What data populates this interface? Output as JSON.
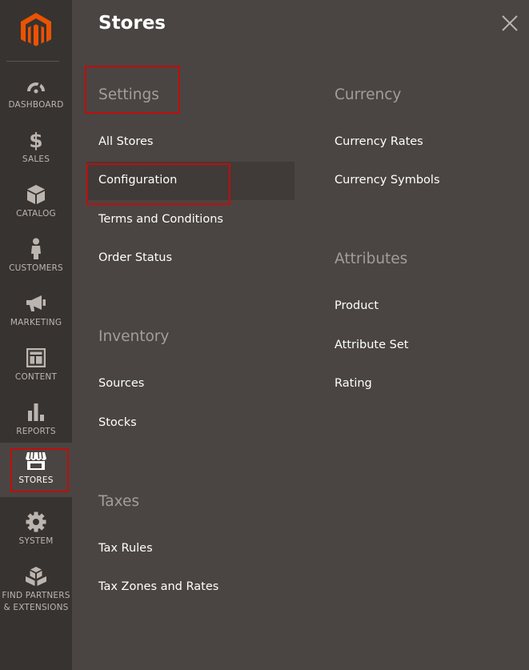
{
  "sidebar": {
    "items": [
      {
        "label": "DASHBOARD",
        "icon": "dashboard-gauge-icon"
      },
      {
        "label": "SALES",
        "icon": "dollar-sign-icon"
      },
      {
        "label": "CATALOG",
        "icon": "cube-icon"
      },
      {
        "label": "CUSTOMERS",
        "icon": "person-icon"
      },
      {
        "label": "MARKETING",
        "icon": "megaphone-icon"
      },
      {
        "label": "CONTENT",
        "icon": "layout-icon"
      },
      {
        "label": "REPORTS",
        "icon": "bar-chart-icon"
      },
      {
        "label": "STORES",
        "icon": "storefront-icon"
      },
      {
        "label": "SYSTEM",
        "icon": "gear-icon"
      },
      {
        "label_line1": "FIND PARTNERS",
        "label_line2": "& EXTENSIONS",
        "icon": "blocks-icon"
      }
    ]
  },
  "panel": {
    "title": "Stores",
    "close_icon": "close-icon",
    "sections": {
      "settings": {
        "title": "Settings",
        "items": [
          "All Stores",
          "Configuration",
          "Terms and Conditions",
          "Order Status"
        ]
      },
      "inventory": {
        "title": "Inventory",
        "items": [
          "Sources",
          "Stocks"
        ]
      },
      "taxes": {
        "title": "Taxes",
        "items": [
          "Tax Rules",
          "Tax Zones and Rates"
        ]
      },
      "currency": {
        "title": "Currency",
        "items": [
          "Currency Rates",
          "Currency Symbols"
        ]
      },
      "attributes": {
        "title": "Attributes",
        "items": [
          "Product",
          "Attribute Set",
          "Rating"
        ]
      }
    }
  },
  "colors": {
    "sidebar_bg": "#373330",
    "panel_bg": "#4a4542",
    "logo_orange": "#eb5202",
    "highlight_red": "#c00d0d"
  }
}
